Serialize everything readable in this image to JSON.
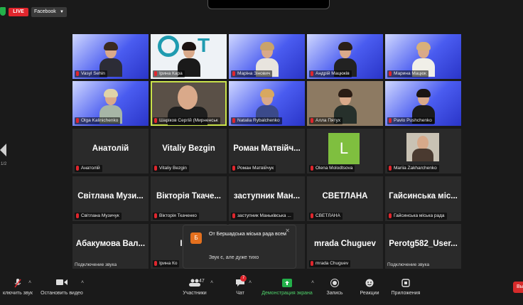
{
  "topbar": {
    "live_label": "LIVE",
    "stream_platform": "Facebook"
  },
  "page_indicator": "1/2",
  "row1": [
    {
      "name": "Vasyl Sehin"
    },
    {
      "name": "Ірина Кара"
    },
    {
      "name": "Маріна Зінович"
    },
    {
      "name": "Андрій Мацюків"
    },
    {
      "name": "Марина Мацюк"
    }
  ],
  "row2": [
    {
      "name": "Olga Kalinichenko"
    },
    {
      "name": "Шаріков Сергій (Мирненськ"
    },
    {
      "name": "Natalia Rybalchenko"
    },
    {
      "name": "Алла Пятух"
    },
    {
      "name": "Pavlo Pushchenko"
    }
  ],
  "row3": [
    {
      "big": "Анатолій",
      "name": "Анатолій"
    },
    {
      "big": "Vitaliy Bezgin",
      "name": "Vitaliy Bezgin"
    },
    {
      "big": "Роман Матвійч...",
      "name": "Роман Матвійчук"
    },
    {
      "big": "L",
      "name": "Olena Molodtsova"
    },
    {
      "name": "Mariia Zakharchenko"
    }
  ],
  "row4": [
    {
      "big": "Світлана Музи...",
      "name": "Світлана Музичук"
    },
    {
      "big": "Вікторія Ткаче...",
      "name": "Вікторія Ткаченко"
    },
    {
      "big": "заступник Ман...",
      "name": "заступник Маньківська ..."
    },
    {
      "big": "СВЕТЛАНА",
      "name": "СВЕТЛАНА"
    },
    {
      "big": "Гайсинська міс...",
      "name": "Гайсинська міська рада"
    }
  ],
  "row5": [
    {
      "big": "Абакумова Вал...",
      "name": "Подключение звука"
    },
    {
      "big": "Ірин",
      "name": "Ірина Ко"
    },
    {
      "big": "",
      "name": ""
    },
    {
      "big": "mrada Chuguev",
      "name": "mrada Chuguev"
    },
    {
      "big": "Perotg582_User...",
      "name": "Подключение звука"
    }
  ],
  "notification": {
    "avatar": "Б",
    "title": "От Бершадська міська рада всем",
    "message": "Звук є, але дуже тихо"
  },
  "toolbar": {
    "mute_label": "ключить звук",
    "video_label": "Остановить видео",
    "participants_label": "Участники",
    "participants_count": "47",
    "chat_label": "Чат",
    "chat_badge": "7",
    "share_label": "Демонстрация экрана",
    "record_label": "Запись",
    "reactions_label": "Реакции",
    "apps_label": "Приложения",
    "end_label": "Вы"
  },
  "colors": {
    "live": "#e0262d",
    "share": "#23b04a",
    "active_speaker": "#c9e24a",
    "end": "#d62b2b"
  }
}
